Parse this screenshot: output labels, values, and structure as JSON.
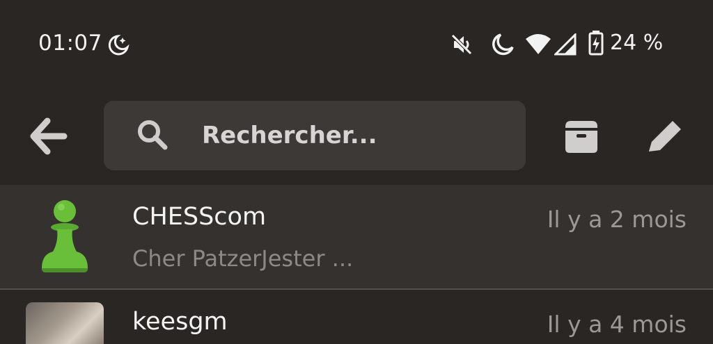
{
  "status_bar": {
    "time": "01:07",
    "battery_percent": "24 %",
    "icons": [
      "do-not-disturb-moon-icon",
      "mute-icon",
      "night-mode-icon",
      "wifi-icon",
      "signal-icon",
      "battery-charging-icon"
    ]
  },
  "toolbar": {
    "back_icon": "arrow-left-icon",
    "search_placeholder": "Rechercher...",
    "archive_icon": "archive-box-icon",
    "compose_icon": "pencil-icon"
  },
  "conversations": [
    {
      "name": "CHESScom",
      "time": "Il y a 2 mois",
      "preview": "Cher PatzerJester ...",
      "avatar": "chess-pawn-icon",
      "selected": true
    },
    {
      "name": "keesgm",
      "time": "Il y a 4 mois",
      "preview": "",
      "avatar": "user-photo"
    }
  ],
  "colors": {
    "background": "#2a2624",
    "search_bg": "#3d3937",
    "selected_row": "#35312f",
    "pawn_green": "#6abf3a"
  }
}
